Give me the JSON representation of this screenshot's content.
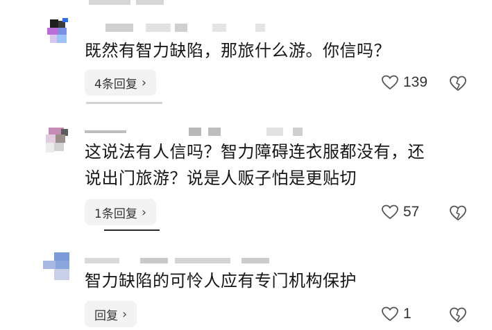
{
  "comments": [
    {
      "text_lines": [
        "既然有智力缺陷，那旅什么游。你信吗？"
      ],
      "reply_label": "4条回复",
      "like_count": "139"
    },
    {
      "text_lines": [
        "这说法有人信吗？智力障碍连衣服都没有，还",
        "说出门旅游？说是人贩子怕是更贴切"
      ],
      "reply_label": "1条回复",
      "like_count": "57"
    },
    {
      "text_lines": [
        "智力缺陷的可怜人应有专门机构保护"
      ],
      "reply_label": "回复",
      "like_count": "1"
    }
  ],
  "icons": {
    "reply_chevron": "chevron-right-icon",
    "like": "heart-outline-icon",
    "dislike": "broken-heart-icon"
  },
  "colors": {
    "text": "#161616",
    "reply_button_bg": "#f3f3f3",
    "icon_stroke": "#555555"
  }
}
